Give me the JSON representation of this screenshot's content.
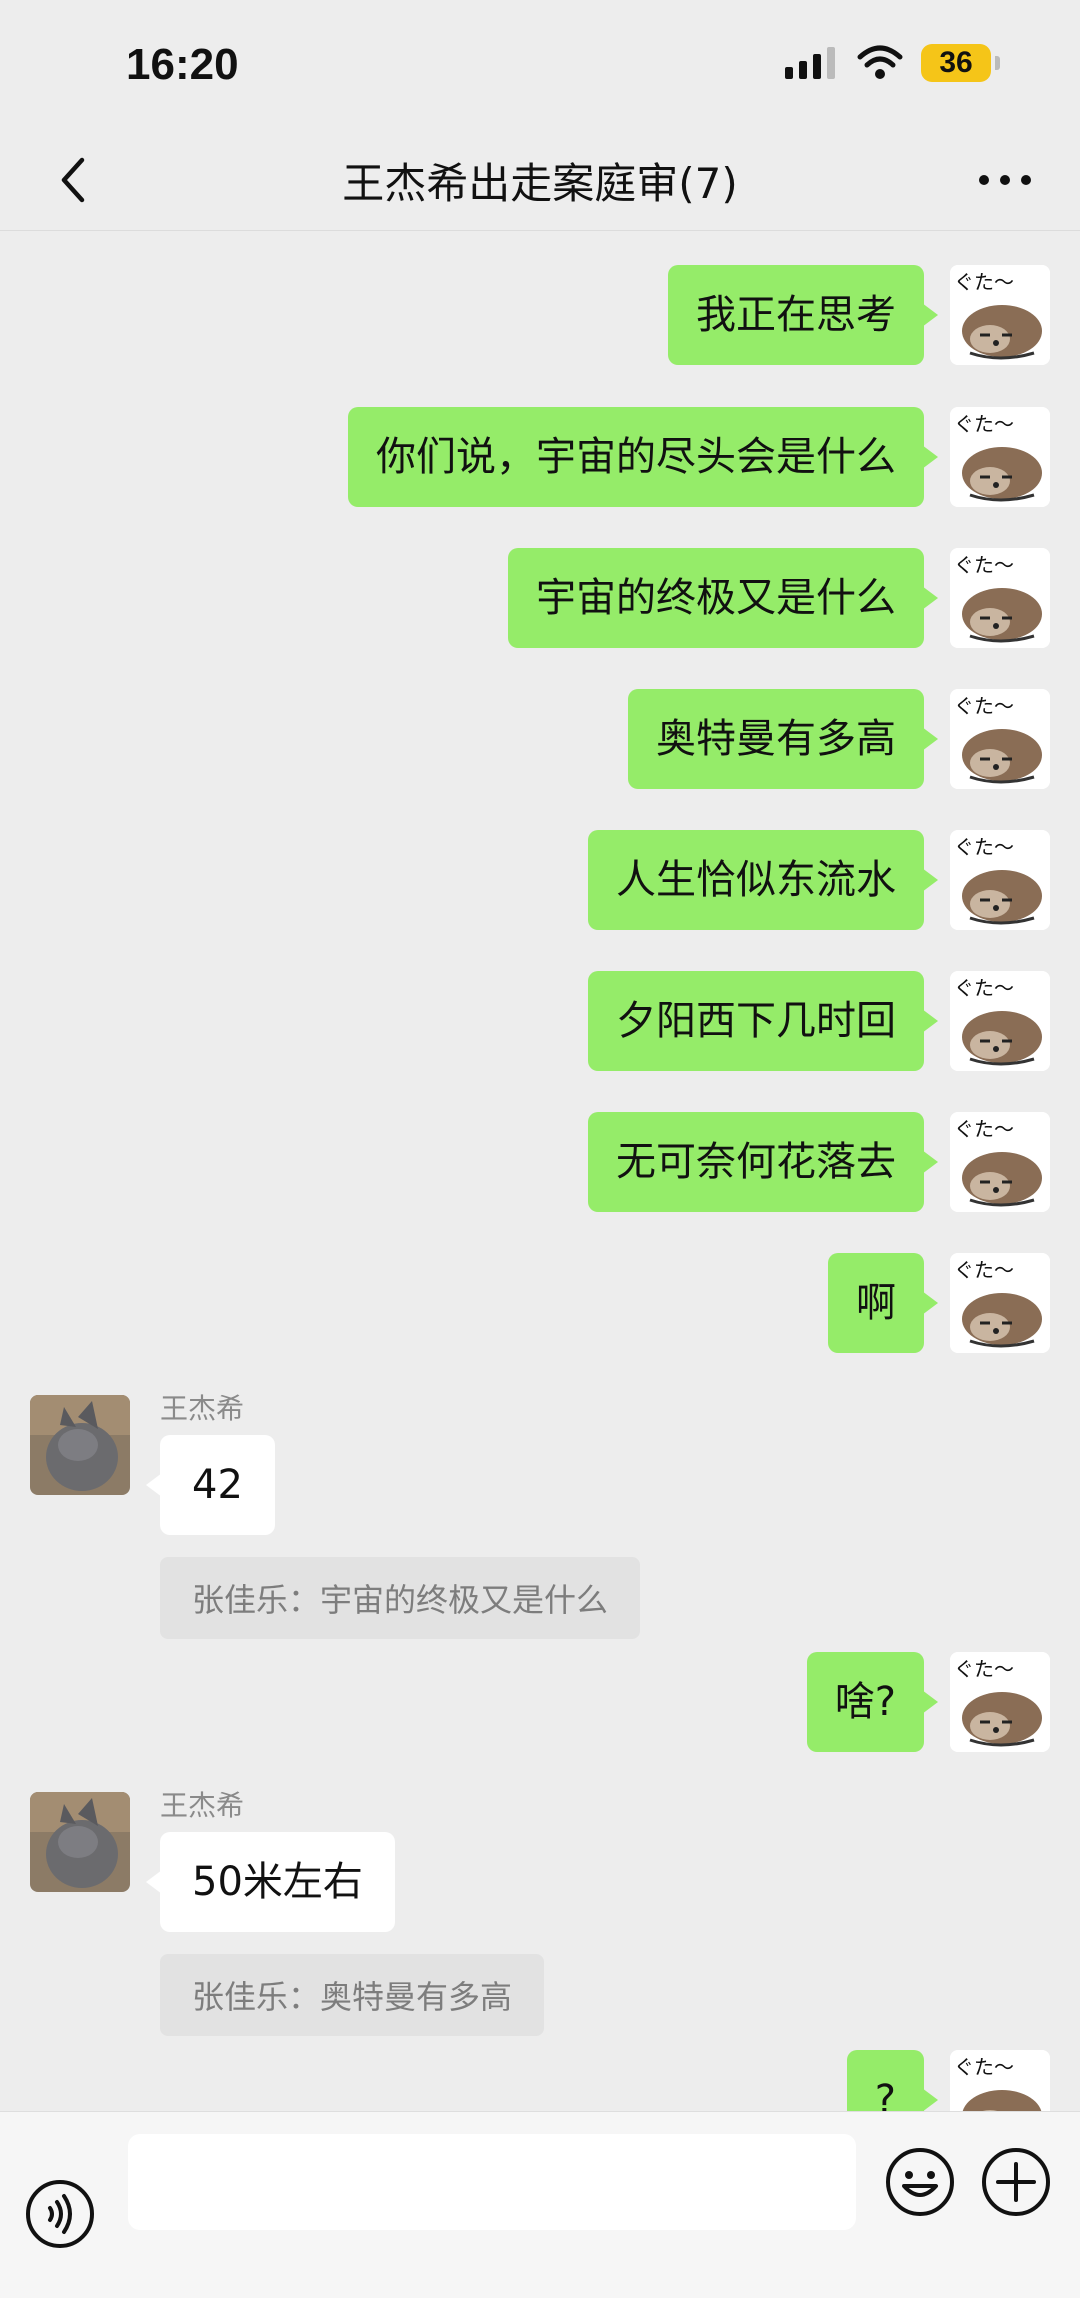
{
  "status": {
    "time": "16:20",
    "battery": "36"
  },
  "header": {
    "title": "王杰希出走案庭审(7)"
  },
  "messages": [
    {
      "dir": "out",
      "text": "我正在思考"
    },
    {
      "dir": "out",
      "text": "你们说，宇宙的尽头会是什么"
    },
    {
      "dir": "out",
      "text": "宇宙的终极又是什么"
    },
    {
      "dir": "out",
      "text": "奥特曼有多高"
    },
    {
      "dir": "out",
      "text": "人生恰似东流水"
    },
    {
      "dir": "out",
      "text": "夕阳西下几时回"
    },
    {
      "dir": "out",
      "text": "无可奈何花落去"
    },
    {
      "dir": "out",
      "text": "啊"
    },
    {
      "dir": "in",
      "sender": "王杰希",
      "text": "42",
      "quote": "张佳乐：宇宙的终极又是什么"
    },
    {
      "dir": "out",
      "text": "啥?"
    },
    {
      "dir": "in",
      "sender": "王杰希",
      "text": "50米左右",
      "quote": "张佳乐：奥特曼有多高"
    },
    {
      "dir": "out",
      "text": "?"
    }
  ],
  "input": {
    "placeholder": ""
  },
  "icons": {
    "back": "chevron-left-icon",
    "more": "more-dots-icon",
    "voice": "voice-icon",
    "emoji": "emoji-icon",
    "plus": "plus-icon"
  },
  "colors": {
    "bubble_out": "#95ec69",
    "bubble_in": "#ffffff",
    "background": "#ededed"
  }
}
